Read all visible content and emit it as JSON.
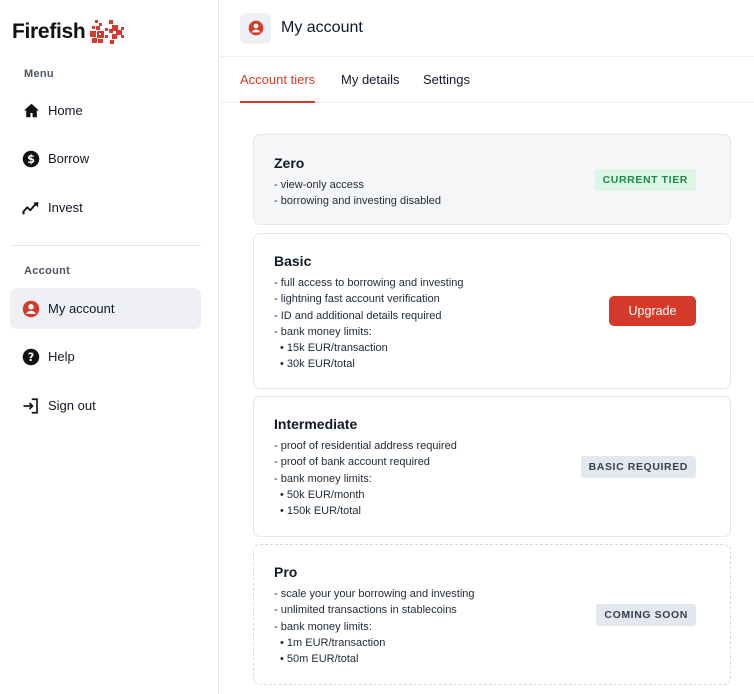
{
  "app": {
    "name": "Firefish"
  },
  "colors": {
    "accent": "#d53a2a",
    "sidebar_active": "#eef0f5",
    "badge_green_bg": "#dcf5e5",
    "badge_green_text": "#1f8a4c"
  },
  "sidebar": {
    "menu_label": "Menu",
    "menu_items": [
      {
        "label": "Home",
        "icon": "home-icon"
      },
      {
        "label": "Borrow",
        "icon": "dollar-icon"
      },
      {
        "label": "Invest",
        "icon": "trend-icon"
      }
    ],
    "account_label": "Account",
    "account_items": [
      {
        "label": "My account",
        "icon": "user-circle-icon"
      },
      {
        "label": "Help",
        "icon": "help-icon"
      },
      {
        "label": "Sign out",
        "icon": "sign-out-icon"
      }
    ]
  },
  "header": {
    "title": "My account"
  },
  "tabs": [
    {
      "label": "Account tiers"
    },
    {
      "label": "My details"
    },
    {
      "label": "Settings"
    }
  ],
  "tiers": [
    {
      "name": "Zero",
      "lines": [
        "- view-only access",
        "- borrowing and investing disabled"
      ],
      "badge": "CURRENT TIER"
    },
    {
      "name": "Basic",
      "lines": [
        "- full access to borrowing and investing",
        "- lightning fast account verification",
        "- ID and additional details required",
        "- bank money limits:",
        "• 15k EUR/transaction",
        "• 30k EUR/total"
      ],
      "button": "Upgrade"
    },
    {
      "name": "Intermediate",
      "lines": [
        "- proof of residential address required",
        "- proof of bank account required",
        "- bank money limits:",
        "• 50k EUR/month",
        "• 150k EUR/total"
      ],
      "badge": "BASIC REQUIRED"
    },
    {
      "name": "Pro",
      "lines": [
        "- scale your your borrowing and investing",
        "- unlimited transactions in stablecoins",
        "- bank money limits:",
        "• 1m EUR/transaction",
        "• 50m EUR/total"
      ],
      "badge": "COMING SOON"
    }
  ]
}
